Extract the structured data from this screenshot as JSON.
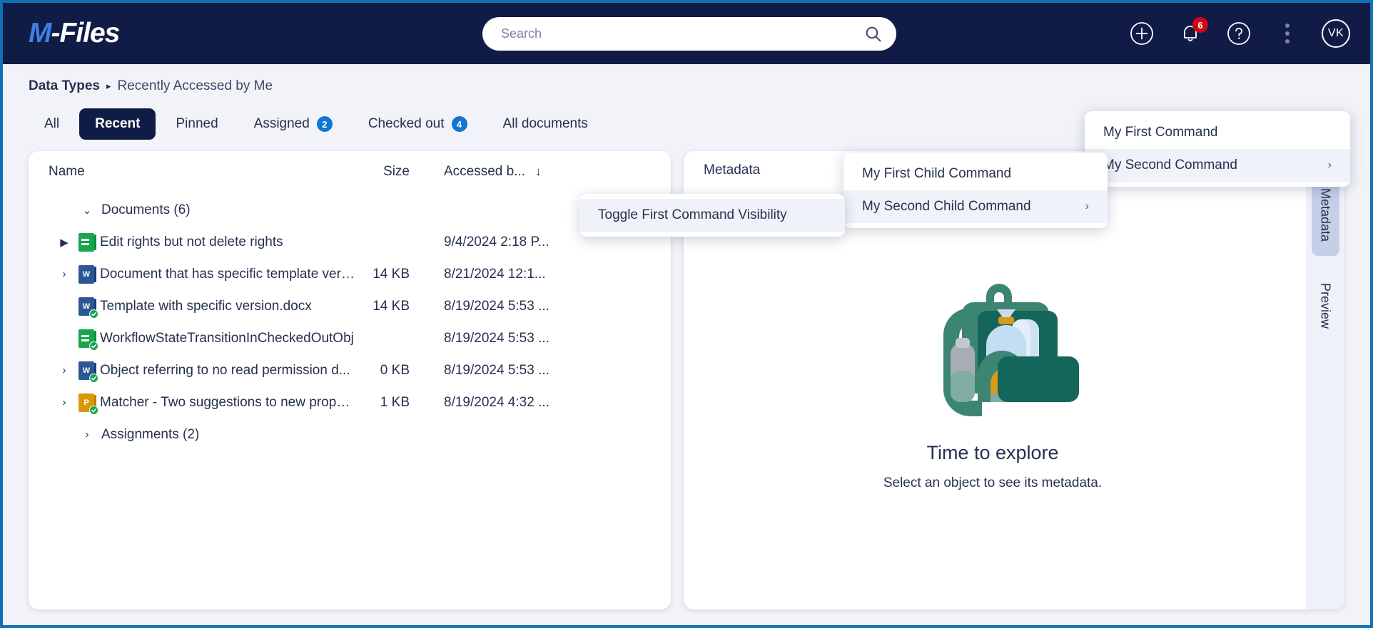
{
  "app": {
    "logo_m": "M",
    "logo_rest": "-Files"
  },
  "search": {
    "placeholder": "Search",
    "value": "",
    "icon": "search-icon"
  },
  "top_actions": {
    "add_icon": "plus-circle-icon",
    "notifications_icon": "bell-icon",
    "notifications_count": "6",
    "help_icon": "question-circle-icon",
    "more_icon": "kebab-menu-icon",
    "avatar_initials": "VK"
  },
  "breadcrumb": {
    "root": "Data Types",
    "separator": "▸",
    "leaf": "Recently Accessed by Me"
  },
  "tabs": [
    {
      "label": "All",
      "count": "",
      "active": false
    },
    {
      "label": "Recent",
      "count": "",
      "active": true
    },
    {
      "label": "Pinned",
      "count": "",
      "active": false
    },
    {
      "label": "Assigned",
      "count": "2",
      "active": false
    },
    {
      "label": "Checked out",
      "count": "4",
      "active": false
    },
    {
      "label": "All documents",
      "count": "",
      "active": false
    }
  ],
  "list": {
    "columns": {
      "name": "Name",
      "size": "Size",
      "accessed": "Accessed b...",
      "sort_arrow": "↓"
    },
    "groups": [
      {
        "label": "Documents (6)",
        "expanded": true,
        "chevron": "⌄",
        "rows": [
          {
            "chevron": "▶",
            "icon": "document-green-icon",
            "icon_kind": "green",
            "icon_letter": "",
            "checked": false,
            "name": "Edit rights but not delete rights",
            "size": "",
            "accessed": "9/4/2024 2:18 P..."
          },
          {
            "chevron": "›",
            "icon": "word-document-icon",
            "icon_kind": "word",
            "icon_letter": "W",
            "checked": false,
            "name": "Document that has specific template vers...",
            "size": "14 KB",
            "accessed": "8/21/2024 12:1..."
          },
          {
            "chevron": "",
            "icon": "word-document-checked-out-icon",
            "icon_kind": "word",
            "icon_letter": "W",
            "checked": true,
            "name": "Template with specific version.docx",
            "size": "14 KB",
            "accessed": "8/19/2024 5:53 ..."
          },
          {
            "chevron": "",
            "icon": "document-green-checked-out-icon",
            "icon_kind": "green",
            "icon_letter": "",
            "checked": true,
            "name": "WorkflowStateTransitionInCheckedOutObj",
            "size": "",
            "accessed": "8/19/2024 5:53 ..."
          },
          {
            "chevron": "›",
            "icon": "word-document-checked-out-icon",
            "icon_kind": "word",
            "icon_letter": "W",
            "checked": true,
            "name": "Object referring to no read permission d...",
            "size": "0 KB",
            "accessed": "8/19/2024 5:53 ..."
          },
          {
            "chevron": "›",
            "icon": "powerpoint-document-checked-out-icon",
            "icon_kind": "amber",
            "icon_letter": "P",
            "checked": true,
            "name": "Matcher - Two suggestions to new proper...",
            "size": "1 KB",
            "accessed": "8/19/2024 4:32 ..."
          }
        ]
      },
      {
        "label": "Assignments (2)",
        "expanded": false,
        "chevron": "›",
        "rows": []
      }
    ]
  },
  "metadata_panel": {
    "title": "Metadata",
    "expand_icon": "expand-fullscreen-icon",
    "collapse_icon": "panel-collapse-icon",
    "empty_title": "Time to explore",
    "empty_subtitle": "Select an object to see its metadata.",
    "illustration": "backpack-illustration",
    "side_tabs": [
      {
        "label": "Metadata",
        "active": true
      },
      {
        "label": "Preview",
        "active": false
      }
    ]
  },
  "menus": {
    "root": [
      {
        "label": "My First Command",
        "has_submenu": false,
        "highlighted": false
      },
      {
        "label": "My Second Command",
        "has_submenu": true,
        "highlighted": true,
        "arrow": "›"
      }
    ],
    "child": [
      {
        "label": "My First Child Command",
        "has_submenu": false,
        "highlighted": false
      },
      {
        "label": "My Second Child Command",
        "has_submenu": true,
        "highlighted": true,
        "arrow": "›"
      }
    ],
    "grandchild": [
      {
        "label": "Toggle First Command Visibility",
        "has_submenu": false,
        "highlighted": true
      }
    ]
  },
  "colors": {
    "brand_navy": "#101c46",
    "brand_blue": "#3f7fe0",
    "badge_red": "#d40511",
    "count_blue": "#1175d4",
    "frame_blue": "#0f72b5"
  }
}
